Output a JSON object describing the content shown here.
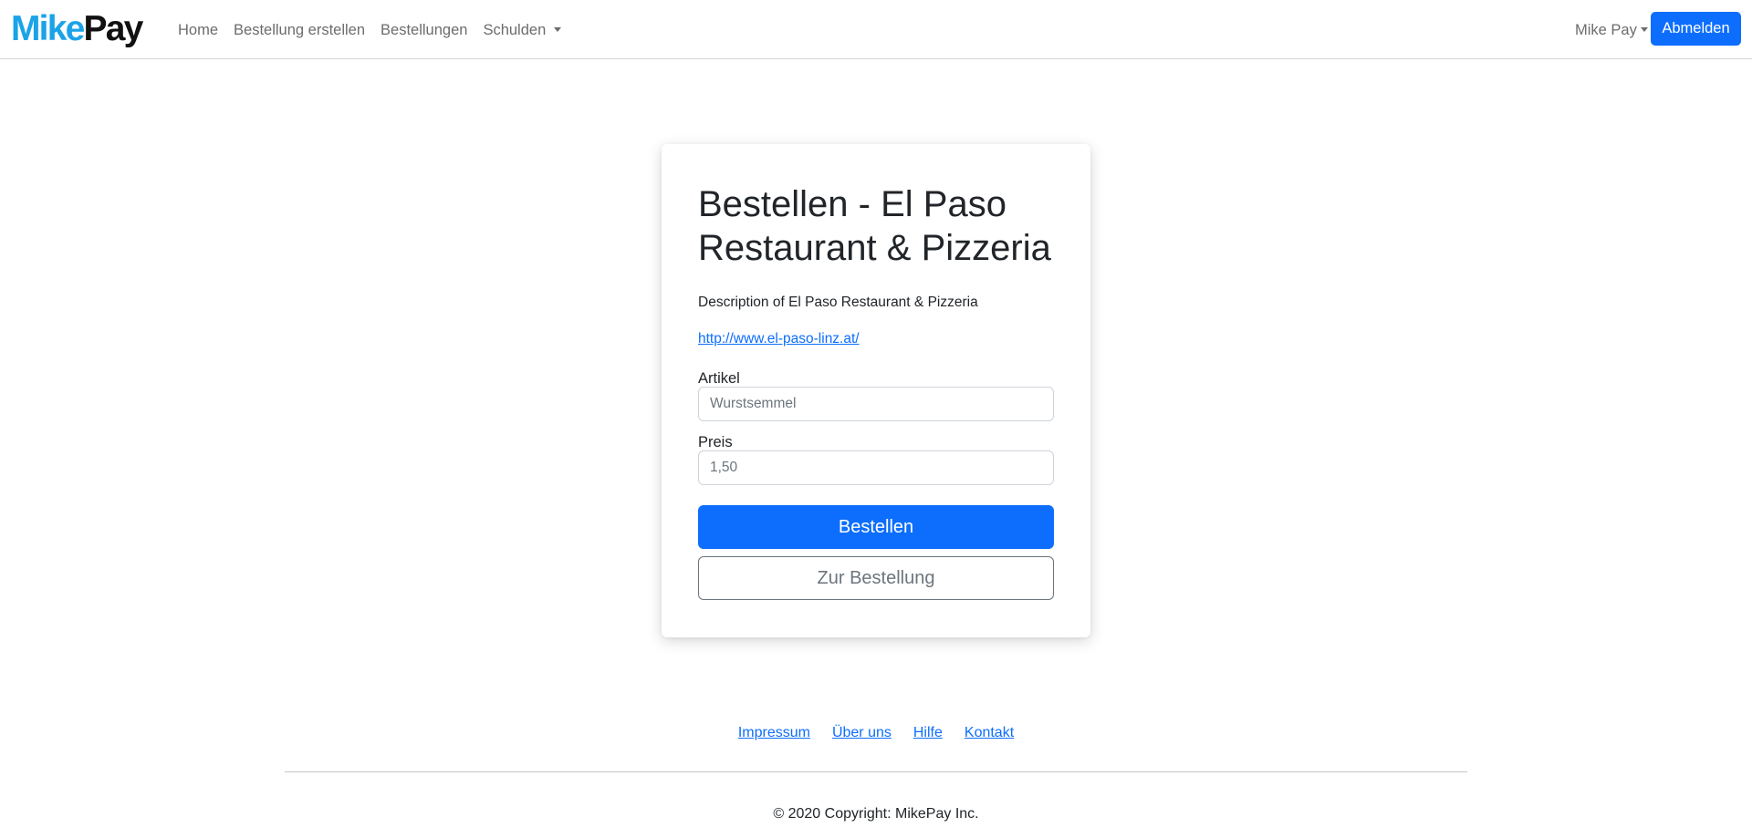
{
  "navbar": {
    "brand_part1": "Mike",
    "brand_part2": "Pay",
    "links": {
      "home": "Home",
      "create_order": "Bestellung erstellen",
      "orders": "Bestellungen",
      "debts": "Schulden"
    },
    "user_name": "Mike Pay",
    "logout_label": "Abmelden"
  },
  "card": {
    "title": "Bestellen - El Paso Restaurant & Pizzeria",
    "description": "Description of El Paso Restaurant & Pizzeria",
    "link": "http://www.el-paso-linz.at/",
    "article": {
      "label": "Artikel",
      "placeholder": "Wurstsemmel",
      "value": ""
    },
    "price": {
      "label": "Preis",
      "placeholder": "1,50",
      "value": ""
    },
    "submit_label": "Bestellen",
    "back_label": "Zur Bestellung"
  },
  "footer": {
    "links": {
      "impressum": "Impressum",
      "about": "Über uns",
      "help": "Hilfe",
      "contact": "Kontakt"
    },
    "copyright": "© 2020 Copyright: MikePay Inc."
  },
  "colors": {
    "primary": "#0d6efd",
    "brand_blue": "#1aa3e8",
    "brand_dark": "#111111",
    "nav_text": "#6c6c6c",
    "outline": "#6c757d"
  }
}
